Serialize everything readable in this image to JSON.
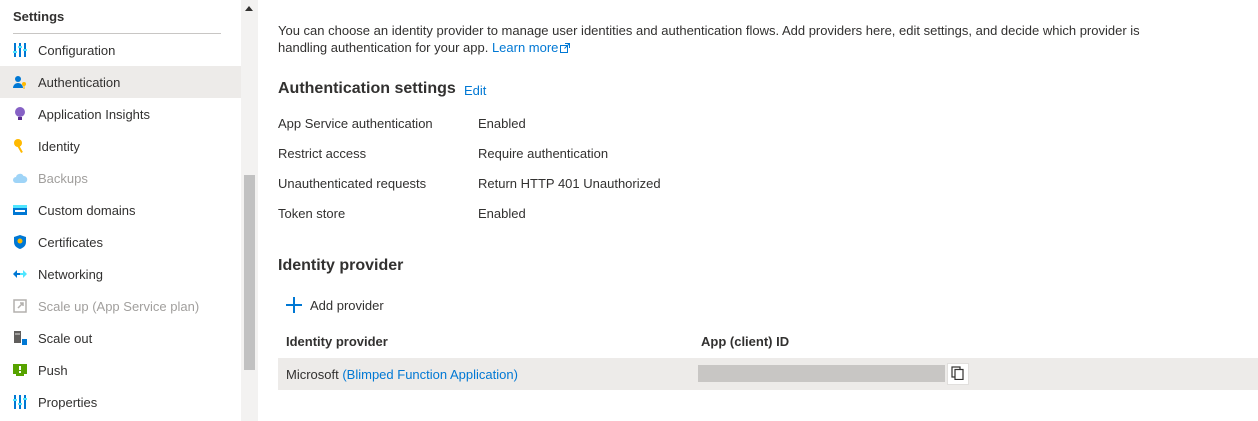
{
  "sidebar": {
    "section_title": "Settings",
    "items": [
      {
        "label": "Configuration",
        "icon": "sliders-icon",
        "active": false,
        "disabled": false
      },
      {
        "label": "Authentication",
        "icon": "user-key-icon",
        "active": true,
        "disabled": false
      },
      {
        "label": "Application Insights",
        "icon": "lightbulb-icon",
        "active": false,
        "disabled": false
      },
      {
        "label": "Identity",
        "icon": "key-icon",
        "active": false,
        "disabled": false
      },
      {
        "label": "Backups",
        "icon": "cloud-icon",
        "active": false,
        "disabled": true
      },
      {
        "label": "Custom domains",
        "icon": "www-icon",
        "active": false,
        "disabled": false
      },
      {
        "label": "Certificates",
        "icon": "shield-icon",
        "active": false,
        "disabled": false
      },
      {
        "label": "Networking",
        "icon": "network-icon",
        "active": false,
        "disabled": false
      },
      {
        "label": "Scale up (App Service plan)",
        "icon": "scale-up-icon",
        "active": false,
        "disabled": true
      },
      {
        "label": "Scale out",
        "icon": "scale-out-icon",
        "active": false,
        "disabled": false
      },
      {
        "label": "Push",
        "icon": "push-icon",
        "active": false,
        "disabled": false
      },
      {
        "label": "Properties",
        "icon": "properties-icon",
        "active": false,
        "disabled": false
      }
    ]
  },
  "main": {
    "intro_text": "You can choose an identity provider to manage user identities and authentication flows. Add providers here, edit settings, and decide which provider is handling authentication for your app.",
    "learn_more": "Learn more",
    "auth_settings": {
      "title": "Authentication settings",
      "edit_label": "Edit",
      "rows": [
        {
          "key": "App Service authentication",
          "value": "Enabled"
        },
        {
          "key": "Restrict access",
          "value": "Require authentication"
        },
        {
          "key": "Unauthenticated requests",
          "value": "Return HTTP 401 Unauthorized"
        },
        {
          "key": "Token store",
          "value": "Enabled"
        }
      ]
    },
    "identity_provider": {
      "title": "Identity provider",
      "add_label": "Add provider",
      "columns": [
        "Identity provider",
        "App (client) ID"
      ],
      "rows": [
        {
          "provider": "Microsoft",
          "app_name": "(Blimped Function Application)"
        }
      ]
    }
  },
  "colors": {
    "accent": "#0078d4",
    "selected_bg": "#edebe9",
    "text": "#323130",
    "disabled_text": "#a19f9d"
  }
}
